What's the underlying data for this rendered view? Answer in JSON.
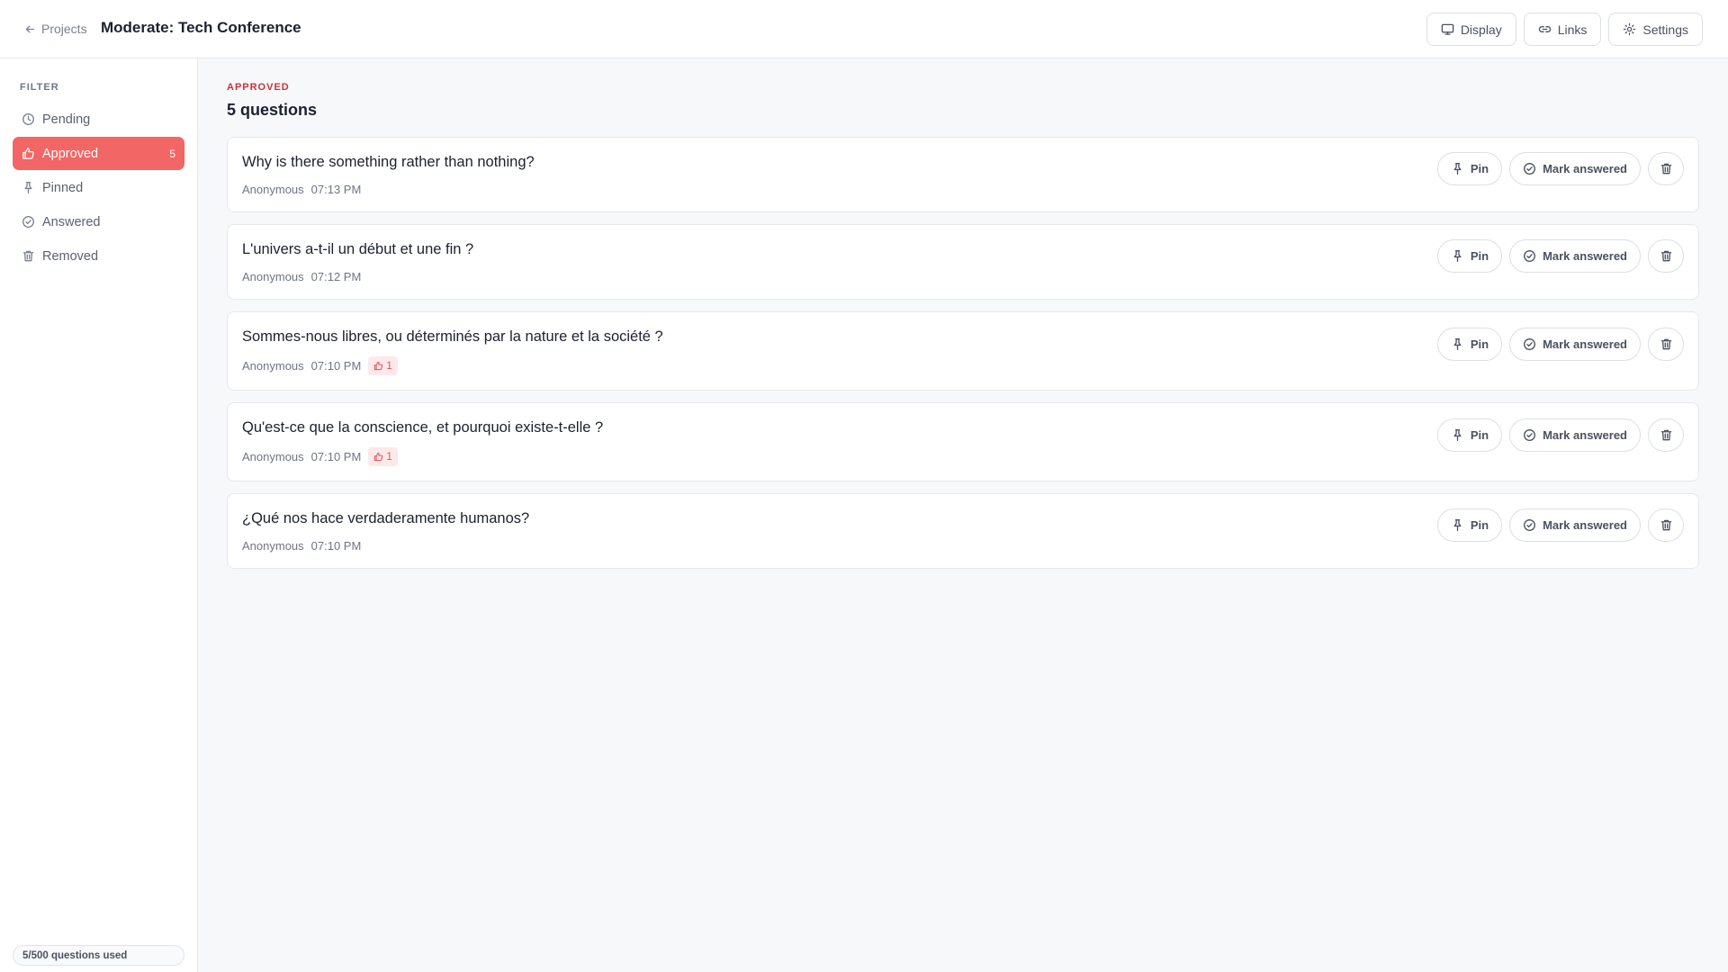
{
  "header": {
    "back_label": "Projects",
    "title": "Moderate: Tech Conference",
    "actions": [
      {
        "label": "Display",
        "icon": "monitor-icon"
      },
      {
        "label": "Links",
        "icon": "link-icon"
      },
      {
        "label": "Settings",
        "icon": "gear-icon"
      }
    ]
  },
  "sidebar": {
    "filter_label": "FILTER",
    "items": [
      {
        "label": "Pending",
        "icon": "clock-icon",
        "active": false,
        "count": ""
      },
      {
        "label": "Approved",
        "icon": "thumbs-up-icon",
        "active": true,
        "count": "5"
      },
      {
        "label": "Pinned",
        "icon": "pin-icon",
        "active": false,
        "count": ""
      },
      {
        "label": "Answered",
        "icon": "check-circle-icon",
        "active": false,
        "count": ""
      },
      {
        "label": "Removed",
        "icon": "trash-icon",
        "active": false,
        "count": ""
      }
    ],
    "usage": "5/500 questions used"
  },
  "main": {
    "eyebrow": "APPROVED",
    "heading": "5 questions",
    "actions": {
      "pin_label": "Pin",
      "answered_label": "Mark answered"
    },
    "questions": [
      {
        "text": "Why is there something rather than nothing?",
        "author": "Anonymous",
        "time": "07:13 PM",
        "likes": ""
      },
      {
        "text": "L'univers a-t-il un début et une fin ?",
        "author": "Anonymous",
        "time": "07:12 PM",
        "likes": ""
      },
      {
        "text": "Sommes-nous libres, ou déterminés par la nature et la société ?",
        "author": "Anonymous",
        "time": "07:10 PM",
        "likes": "1"
      },
      {
        "text": "Qu'est-ce que la conscience, et pourquoi existe-t-elle ?",
        "author": "Anonymous",
        "time": "07:10 PM",
        "likes": "1"
      },
      {
        "text": "¿Qué nos hace verdaderamente humanos?",
        "author": "Anonymous",
        "time": "07:10 PM",
        "likes": ""
      }
    ]
  },
  "colors": {
    "accent": "#f26666",
    "eyebrow": "#c8333d",
    "like_badge_bg": "#fde8ea"
  }
}
